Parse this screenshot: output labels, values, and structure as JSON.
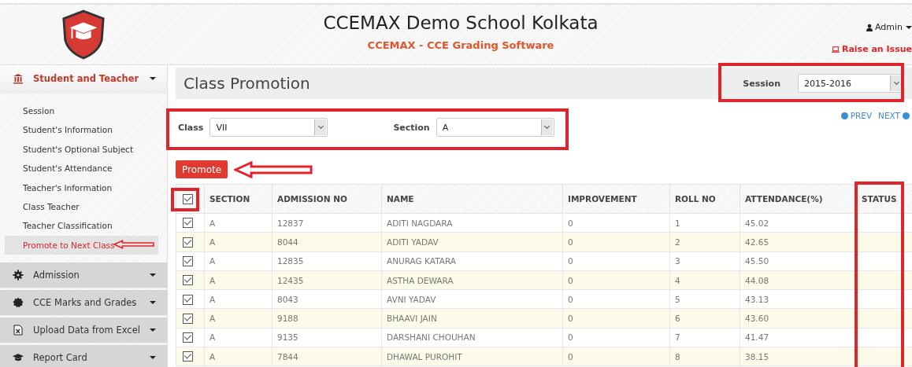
{
  "header": {
    "title": "CCEMAX Demo School Kolkata",
    "subtitle": "CCEMAX - CCE Grading Software",
    "user_menu": "Admin",
    "raise_issue": "Raise an Issue"
  },
  "sidebar": {
    "sections": [
      {
        "label": "Student and Teacher",
        "expanded": true,
        "items": [
          {
            "label": "Session",
            "selected": false
          },
          {
            "label": "Student's Information",
            "selected": false
          },
          {
            "label": "Student's Optional Subject",
            "selected": false
          },
          {
            "label": "Student's Attendance",
            "selected": false
          },
          {
            "label": "Teacher's Information",
            "selected": false
          },
          {
            "label": "Class Teacher",
            "selected": false
          },
          {
            "label": "Teacher Classification",
            "selected": false
          },
          {
            "label": "Promote to Next Class",
            "selected": true
          }
        ]
      },
      {
        "label": "Admission",
        "expanded": false
      },
      {
        "label": "CCE Marks and Grades",
        "expanded": false
      },
      {
        "label": "Upload Data from Excel",
        "expanded": false
      },
      {
        "label": "Report Card",
        "expanded": false
      }
    ]
  },
  "page_title": "Class Promotion",
  "session": {
    "label": "Session",
    "value": "2015-2016"
  },
  "filters": [
    {
      "label": "Class",
      "value": "VII"
    },
    {
      "label": "Section",
      "value": "A"
    }
  ],
  "pager": {
    "prev": "PREV",
    "next": "NEXT"
  },
  "promote_button": "Promote",
  "table": {
    "select_all_checked": true,
    "columns": [
      "SECTION",
      "ADMISSION NO",
      "NAME",
      "IMPROVEMENT",
      "ROLL NO",
      "ATTENDANCE(%)",
      "STATUS"
    ],
    "rows": [
      {
        "checked": true,
        "cells": [
          "A",
          "12837",
          "ADITI NAGDARA",
          "0",
          "1",
          "45.02"
        ]
      },
      {
        "checked": true,
        "cells": [
          "A",
          "8044",
          "ADITI YADAV",
          "0",
          "2",
          "42.65"
        ]
      },
      {
        "checked": true,
        "cells": [
          "A",
          "12835",
          "ANURAG KATARA",
          "0",
          "3",
          "45.50"
        ]
      },
      {
        "checked": true,
        "cells": [
          "A",
          "12435",
          "ASTHA DEWARA",
          "0",
          "4",
          "44.08"
        ]
      },
      {
        "checked": true,
        "cells": [
          "A",
          "8043",
          "AVNI YADAV",
          "0",
          "5",
          "43.13"
        ]
      },
      {
        "checked": true,
        "cells": [
          "A",
          "9188",
          "BHAAVI JAIN",
          "0",
          "6",
          "43.60"
        ]
      },
      {
        "checked": true,
        "cells": [
          "A",
          "9135",
          "DARSHANI CHOUHAN",
          "0",
          "7",
          "41.47"
        ]
      },
      {
        "checked": true,
        "cells": [
          "A",
          "7844",
          "DHAWAL PUROHIT",
          "0",
          "8",
          "38.15"
        ]
      }
    ]
  }
}
